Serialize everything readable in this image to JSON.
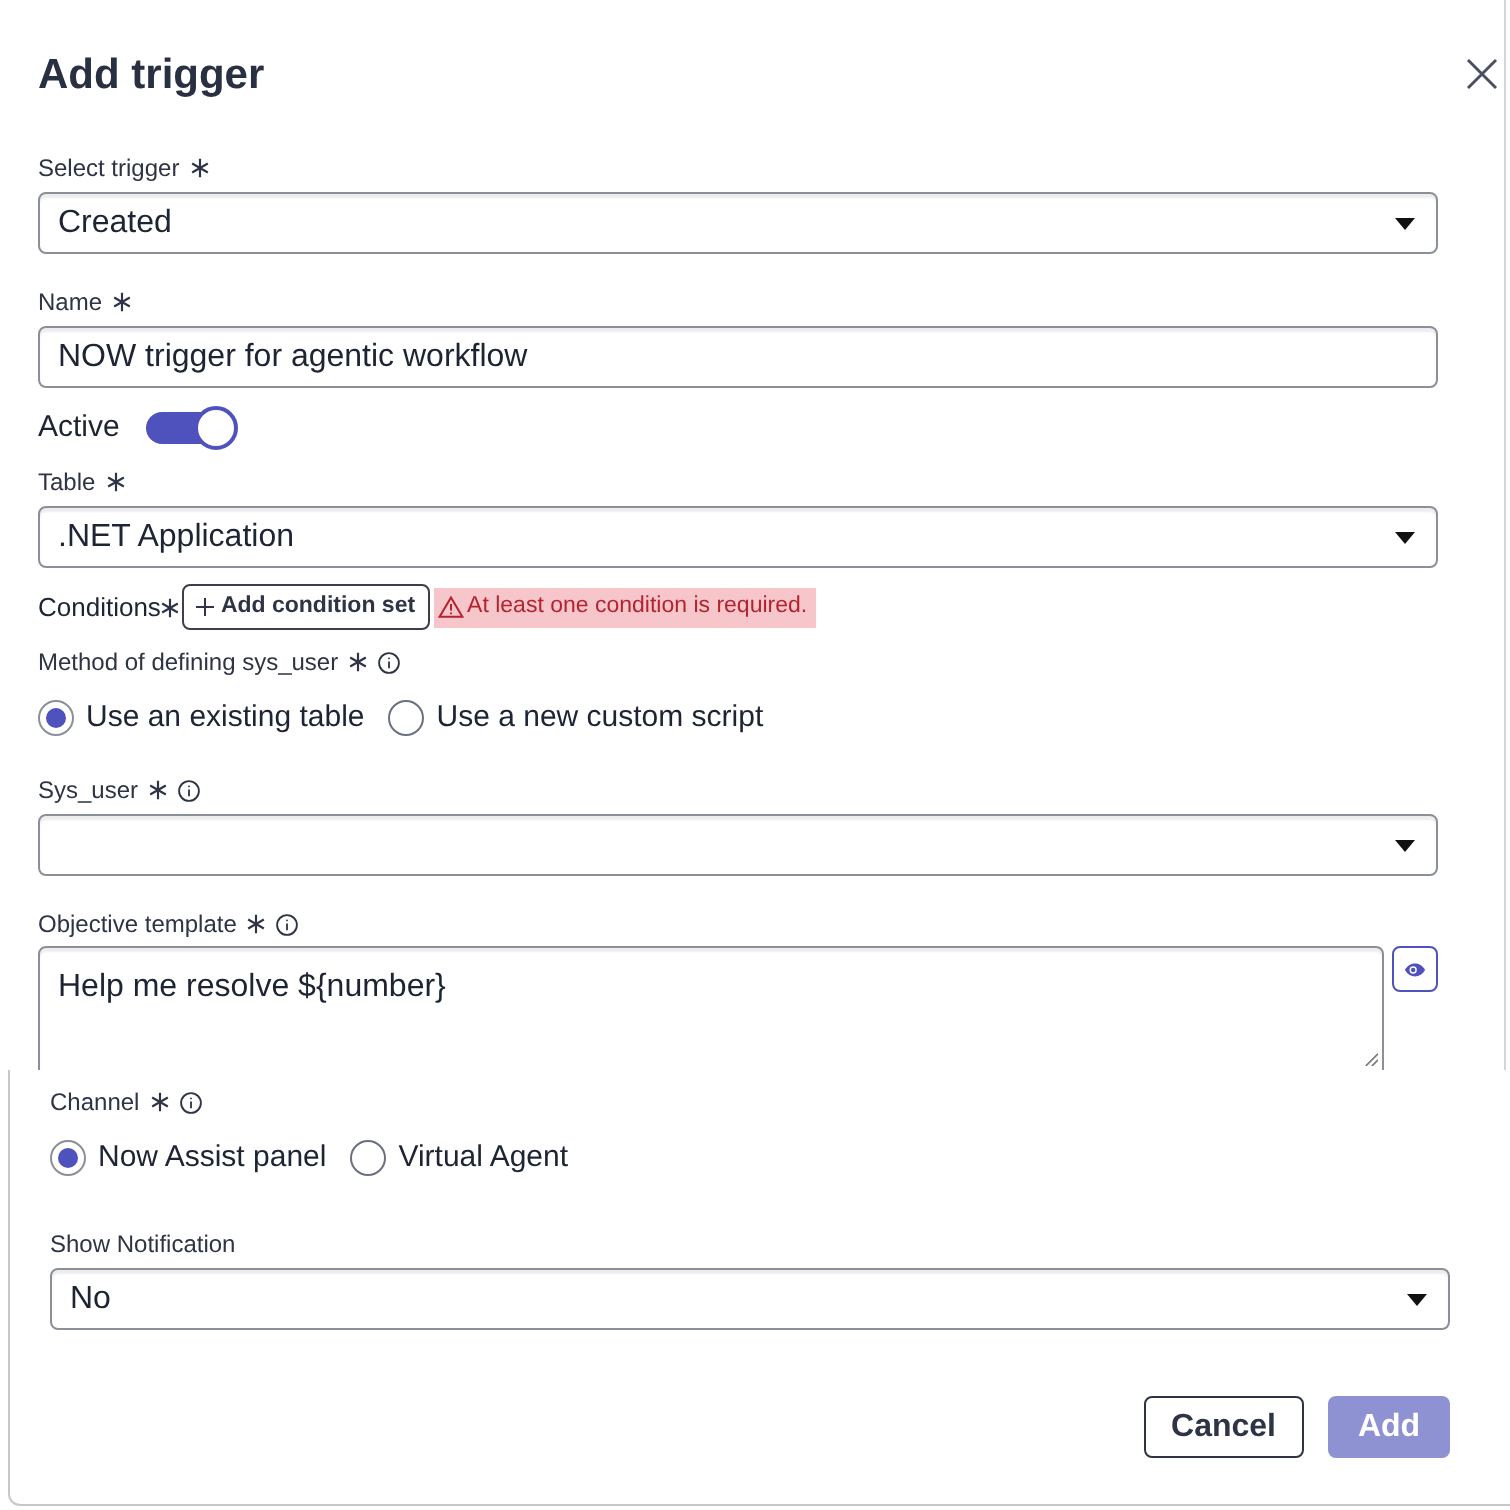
{
  "dialog": {
    "title": "Add trigger"
  },
  "fields": [
    {
      "kind": "select",
      "label": "Select trigger",
      "required": true,
      "info": false,
      "value": "Created"
    },
    {
      "kind": "text",
      "label": "Name",
      "required": true,
      "info": false,
      "value": "NOW trigger for agentic workflow"
    },
    {
      "kind": "toggle",
      "label": "Active",
      "on": true
    },
    {
      "kind": "select",
      "label": "Table",
      "required": true,
      "info": false,
      "value": ".NET Application"
    },
    {
      "kind": "conditions",
      "label": "Conditions",
      "required": true,
      "button": "Add condition set",
      "error": "At least one condition is required."
    },
    {
      "kind": "radio",
      "label": "Method of defining sys_user",
      "required": true,
      "info": true,
      "options": [
        {
          "label": "Use an existing table",
          "selected": true
        },
        {
          "label": "Use a new custom script",
          "selected": false
        }
      ]
    },
    {
      "kind": "select",
      "label": "Sys_user",
      "required": true,
      "info": true
    },
    {
      "kind": "textarea",
      "label": "Objective template",
      "required": true,
      "info": true,
      "value": "Help me resolve ${number}"
    }
  ],
  "lower_fields": [
    {
      "kind": "radio",
      "label": "Channel",
      "required": true,
      "info": true,
      "options": [
        {
          "label": "Now Assist panel",
          "selected": true
        },
        {
          "label": "Virtual Agent",
          "selected": false
        }
      ]
    },
    {
      "kind": "select",
      "label": "Show Notification",
      "required": false,
      "info": false,
      "value": "No"
    }
  ],
  "buttons": [
    {
      "label": "Cancel",
      "kind": "secondary",
      "disabled": false
    },
    {
      "label": "Add",
      "kind": "primary",
      "disabled": true
    }
  ]
}
